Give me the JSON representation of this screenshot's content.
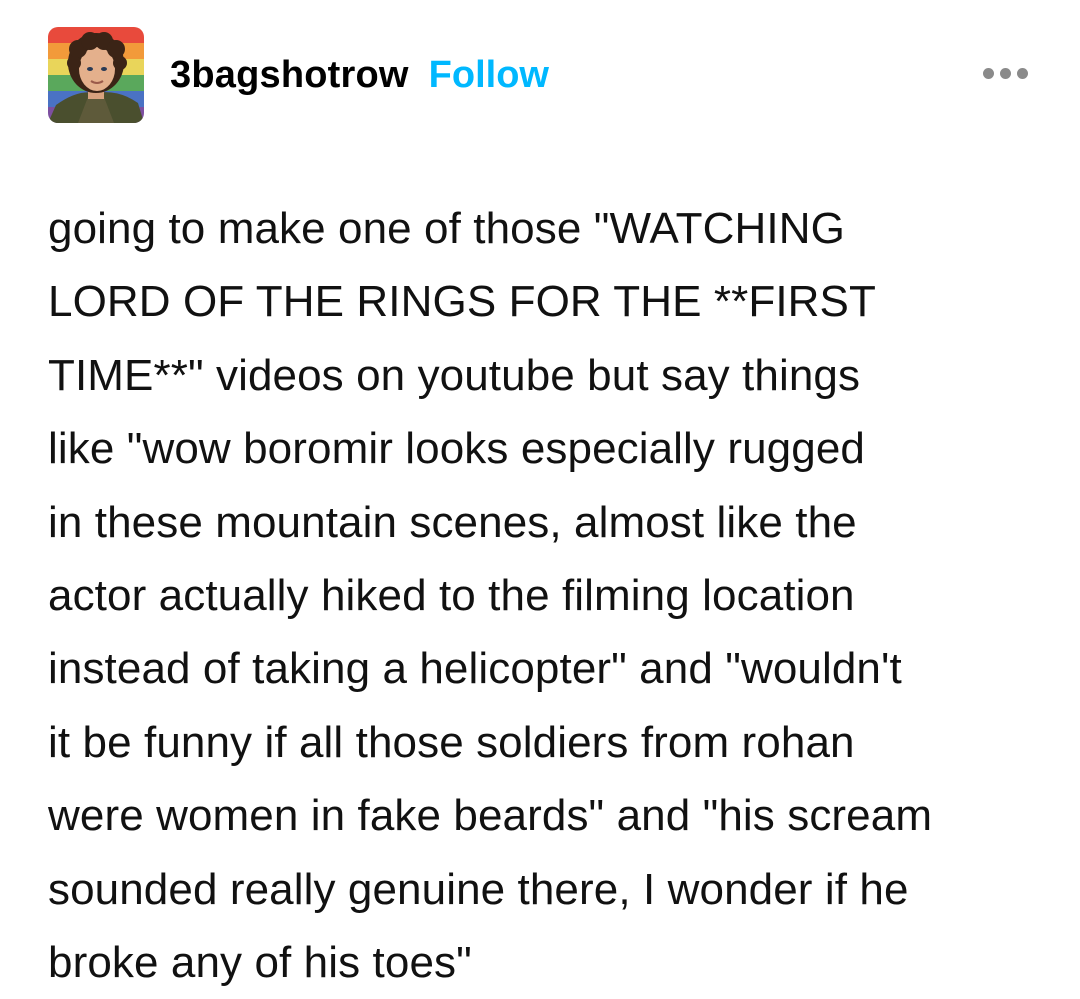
{
  "post": {
    "author": {
      "username": "3bagshotrow",
      "avatar_icon": "avatar-image-icon"
    },
    "follow_label": "Follow",
    "more_icon": "ellipsis-icon",
    "colors": {
      "follow": "#00b8ff",
      "text": "#111111",
      "more_dots": "#8a8a8a"
    },
    "body": "going to make one of those \"WATCHING\nLORD OF THE RINGS FOR THE **FIRST\nTIME**\" videos on youtube but say things\nlike \"wow boromir looks especially rugged\nin these mountain scenes, almost like the\nactor actually hiked to the filming location\ninstead of taking a helicopter\" and \"wouldn't\nit be funny if all those soldiers from rohan\nwere women in fake beards\" and \"his scream\nsounded really genuine there, I wonder if he\nbroke any of his toes\""
  }
}
